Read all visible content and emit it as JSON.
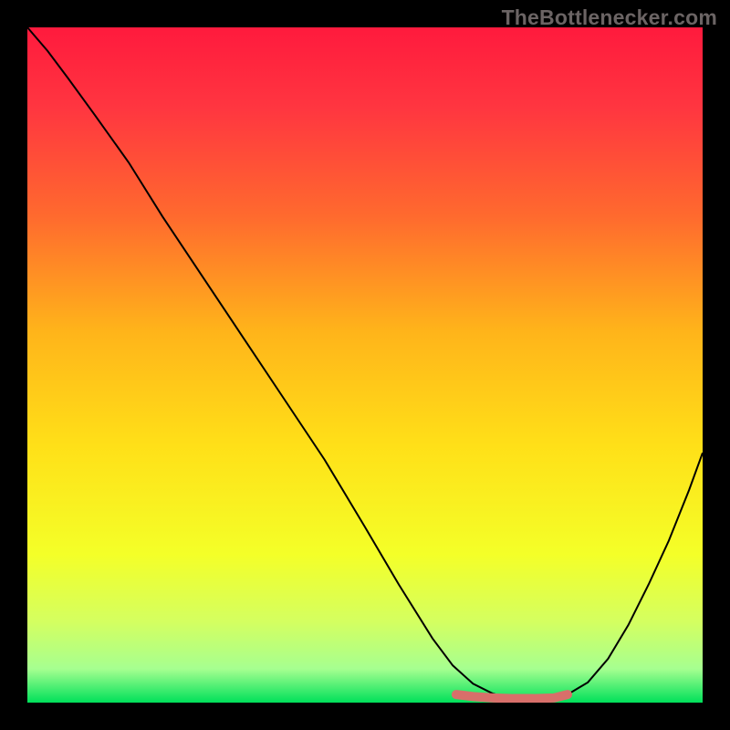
{
  "source_label": "TheBottlenecker.com",
  "chart_data": {
    "type": "line",
    "title": "",
    "xlabel": "",
    "ylabel": "",
    "xlim": [
      0,
      100
    ],
    "ylim": [
      0,
      100
    ],
    "gradient_stops": [
      {
        "offset": 0.0,
        "color": "#ff1a3d"
      },
      {
        "offset": 0.12,
        "color": "#ff3640"
      },
      {
        "offset": 0.28,
        "color": "#ff6a2e"
      },
      {
        "offset": 0.45,
        "color": "#ffb41a"
      },
      {
        "offset": 0.62,
        "color": "#ffe018"
      },
      {
        "offset": 0.78,
        "color": "#f4ff28"
      },
      {
        "offset": 0.88,
        "color": "#d4ff60"
      },
      {
        "offset": 0.95,
        "color": "#a6ff90"
      },
      {
        "offset": 1.0,
        "color": "#00e05a"
      }
    ],
    "series": [
      {
        "name": "bottleneck-curve",
        "color": "#000000",
        "stroke_width": 2,
        "x": [
          0,
          3,
          6,
          10,
          15,
          20,
          26,
          32,
          38,
          44,
          50,
          55,
          60,
          63,
          66,
          69,
          72,
          75,
          78,
          80,
          83,
          86,
          89,
          92,
          95,
          98,
          100
        ],
        "y": [
          100,
          96.5,
          92.5,
          87,
          80,
          72,
          63,
          54,
          45,
          36,
          26,
          17.5,
          9.5,
          5.5,
          2.8,
          1.3,
          0.6,
          0.4,
          0.6,
          1.2,
          3,
          6.5,
          11.5,
          17.5,
          24,
          31.5,
          37
        ]
      },
      {
        "name": "optimal-highlight",
        "color": "#d86f6a",
        "stroke_width": 10,
        "linecap": "round",
        "x": [
          63.5,
          66,
          69,
          72,
          75,
          78,
          80
        ],
        "y": [
          1.2,
          0.9,
          0.7,
          0.6,
          0.6,
          0.7,
          1.2
        ]
      }
    ]
  }
}
